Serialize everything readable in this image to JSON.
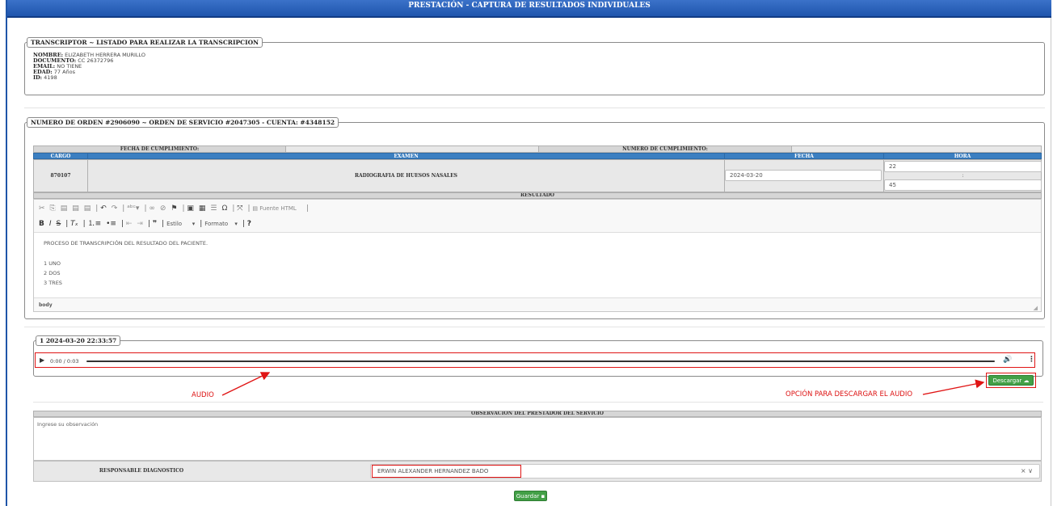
{
  "header": {
    "title": "PRESTACIÓN - CAPTURA DE RESULTADOS INDIVIDUALES"
  },
  "patient": {
    "legend": "TRANSCRIPTOR ~ LISTADO PARA REALIZAR LA TRANSCRIPCION",
    "nombre_label": "NOMBRE:",
    "nombre": "ELIZABETH HERRERA MURILLO",
    "documento_label": "DOCUMENTO:",
    "documento": "CC 26372796",
    "email_label": "EMAIL:",
    "email": "NO TIENE",
    "edad_label": "EDAD:",
    "edad": "77 Años",
    "id_label": "ID:",
    "id": "4198"
  },
  "order": {
    "legend": "NUMERO DE ORDEN #2906090 ~ ORDEN DE SERVICIO #2047305 - CUENTA: #4348152",
    "fecha_cumplimiento_label": "FECHA DE CUMPLIMIENTO:",
    "numero_cumplimiento_label": "NUMERO DE CUMPLIMIENTO:",
    "col_cargo": "CARGO",
    "col_examen": "EXAMEN",
    "col_fecha": "FECHA",
    "col_hora": "HORA",
    "cargo": "870107",
    "examen": "RADIOGRAFIA DE HUESOS NASALES",
    "fecha": "2024-03-20",
    "hora": "22",
    "separator": ":",
    "minuto": "45",
    "resultado_label": "RESULTADO"
  },
  "editor": {
    "source_label": "Fuente HTML",
    "style_label": "Estilo",
    "format_label": "Formato",
    "help": "?",
    "lines": [
      "PROCESO DE TRANSCRIPCIÓN DEL RESULTADO DEL PACIENTE.",
      "1 UNO",
      "2 DOS",
      "3 TRES"
    ],
    "status": "body"
  },
  "audio": {
    "legend": "1 2024-03-20 22:33:57",
    "time": "0:00 / 0:03",
    "progress": 0,
    "download_label": "Descargar",
    "annotation_audio": "AUDIO",
    "annotation_download": "OPCIÓN PARA DESCARGAR EL AUDIO"
  },
  "observation": {
    "header": "OBSERVACIÓN DEL PRESTADOR DEL SERVICIO",
    "placeholder": "Ingrese su observación",
    "responsable_label": "RESPONSABLE DIAGNOSTICO",
    "responsable_value": "ERWIN ALEXANDER HERNANDEZ BADO"
  },
  "actions": {
    "save_label": "Guardar"
  },
  "colors": {
    "header_blue": "#1f55ad",
    "table_blue": "#3b7fc1",
    "annotation_red": "#e01515",
    "button_green": "#43a047"
  }
}
